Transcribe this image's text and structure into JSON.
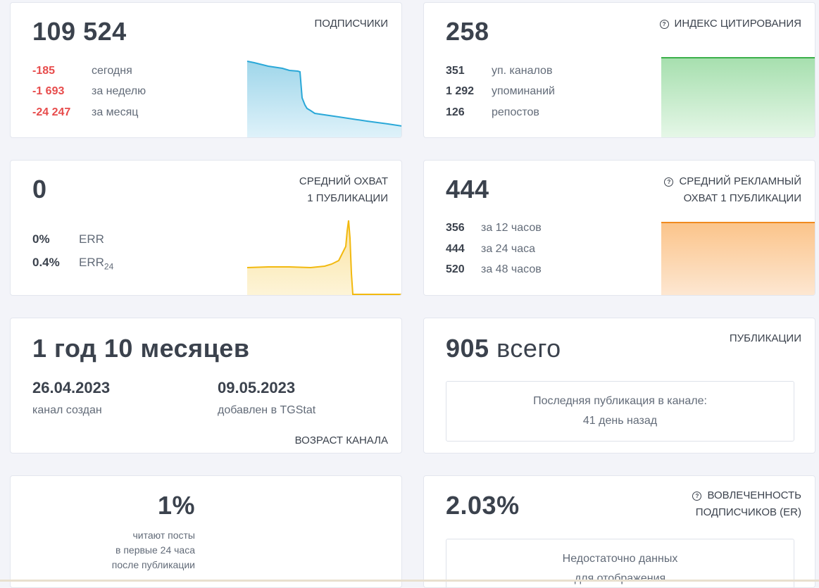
{
  "subscribers": {
    "value": "109 524",
    "label": "ПОДПИСЧИКИ",
    "rows": [
      {
        "value": "-185",
        "text": "сегодня"
      },
      {
        "value": "-1 693",
        "text": "за неделю"
      },
      {
        "value": "-24 247",
        "text": "за месяц"
      }
    ],
    "color": "#2aa8d8"
  },
  "citation": {
    "value": "258",
    "label": "ИНДЕКС ЦИТИРОВАНИЯ",
    "rows": [
      {
        "value": "351",
        "text": "уп. каналов"
      },
      {
        "value": "1 292",
        "text": "упоминаний"
      },
      {
        "value": "126",
        "text": "репостов"
      }
    ],
    "color": "#3cb04a"
  },
  "reach": {
    "value": "0",
    "label_line1": "СРЕДНИЙ ОХВАТ",
    "label_line2": "1 ПУБЛИКАЦИИ",
    "err_value": "0%",
    "err_label": "ERR",
    "err24_value": "0.4%",
    "err24_label": "ERR",
    "err24_sub": "24",
    "color": "#f2b90f"
  },
  "ad_reach": {
    "value": "444",
    "label_line1": "СРЕДНИЙ РЕКЛАМНЫЙ",
    "label_line2": "ОХВАТ 1 ПУБЛИКАЦИИ",
    "rows": [
      {
        "value": "356",
        "text": "за 12 часов"
      },
      {
        "value": "444",
        "text": "за 24 часа"
      },
      {
        "value": "520",
        "text": "за 48 часов"
      }
    ],
    "color": "#f08a1e"
  },
  "age": {
    "value": "1 год 10 месяцев",
    "created_date": "26.04.2023",
    "created_label": "канал создан",
    "added_date": "09.05.2023",
    "added_label": "добавлен в TGStat",
    "label": "ВОЗРАСТ КАНАЛА"
  },
  "posts": {
    "value": "905",
    "value_suffix": "всего",
    "label": "ПУБЛИКАЦИИ",
    "last_line1": "Последняя публикация в канале:",
    "last_line2": "41 день назад"
  },
  "read24": {
    "value": "1%",
    "line1": "читают посты",
    "line2": "в первые 24 часа",
    "line3": "после публикации"
  },
  "er": {
    "value": "2.03%",
    "label_line1": "ВОВЛЕЧЕННОСТЬ",
    "label_line2": "ПОДПИСЧИКОВ (ER)",
    "nodata_line1": "Недостаточно данных",
    "nodata_line2": "для отображения"
  },
  "icons": {
    "question": "?"
  }
}
